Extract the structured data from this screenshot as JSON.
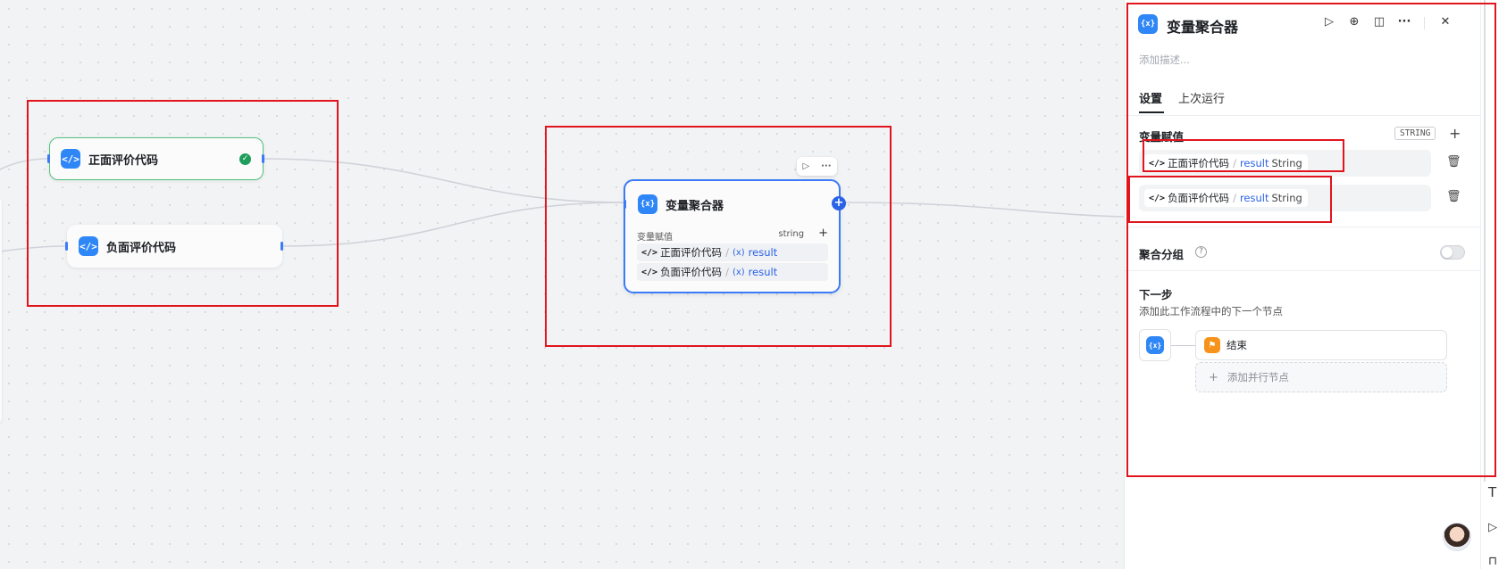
{
  "canvas": {
    "nodes": {
      "positive": {
        "title": "正面评价代码",
        "icon": "code-icon",
        "status": "success"
      },
      "negative": {
        "title": "负面评价代码",
        "icon": "code-icon"
      },
      "aggregator": {
        "title": "变量聚合器",
        "icon": "variable-icon",
        "section_label": "变量赋值",
        "type_label": "string",
        "add_label": "+",
        "variables": [
          {
            "source": "正面评价代码",
            "separator": "/",
            "var_icon": "(x)",
            "var": "result"
          },
          {
            "source": "负面评价代码",
            "separator": "/",
            "var_icon": "(x)",
            "var": "result"
          }
        ]
      }
    }
  },
  "panel": {
    "title": "变量聚合器",
    "description_placeholder": "添加描述...",
    "tabs": [
      "设置",
      "上次运行"
    ],
    "active_tab": 0,
    "toolbar_icons": [
      "run-icon",
      "locate-icon",
      "split-view-icon",
      "more-icon",
      "close-icon"
    ],
    "assignment": {
      "label": "变量赋值",
      "type_tag": "STRING",
      "rows": [
        {
          "source": "正面评价代码",
          "separator": "/",
          "var": "result",
          "type": "String"
        },
        {
          "source": "负面评价代码",
          "separator": "/",
          "var": "result",
          "type": "String"
        }
      ]
    },
    "group": {
      "label": "聚合分组",
      "help": "?",
      "enabled": false
    },
    "next_step": {
      "title": "下一步",
      "subtitle": "添加此工作流程中的下一个节点",
      "next_node": "结束",
      "add_parallel": "添加并行节点",
      "add_prefix": "+"
    }
  },
  "colors": {
    "accent": "#2a63e8",
    "annotation": "#e0151e",
    "success": "#1e9e5a",
    "end_node": "#f7931a"
  }
}
